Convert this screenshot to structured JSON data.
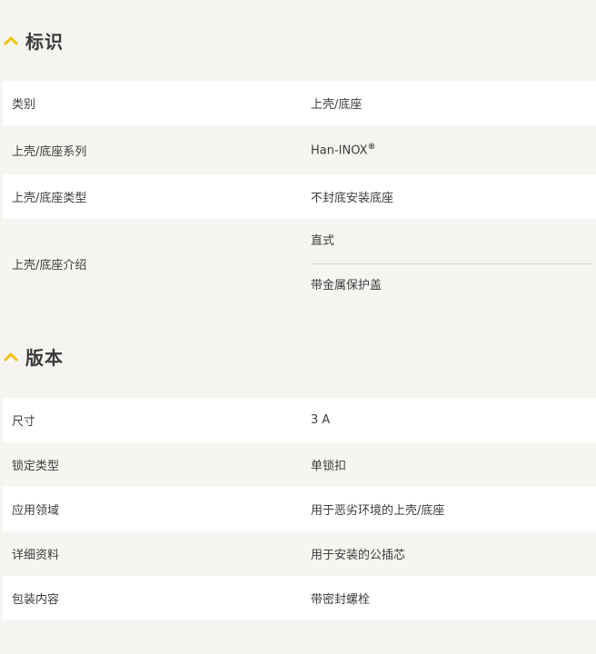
{
  "sections": {
    "identification": {
      "title": "标识",
      "rows": [
        {
          "label": "类别",
          "value": "上壳/底座"
        },
        {
          "label": "上壳/底座系列",
          "value": "Han-INOX",
          "value_sup": "®"
        },
        {
          "label": "上壳/底座类型",
          "value": "不封底安装底座"
        },
        {
          "label": "上壳/底座介绍",
          "values": [
            "直式",
            "带金属保护盖"
          ]
        }
      ]
    },
    "version": {
      "title": "版本",
      "rows": [
        {
          "label": "尺寸",
          "value": "3 A"
        },
        {
          "label": "锁定类型",
          "value": "单锁扣"
        },
        {
          "label": "应用领域",
          "value": "用于恶劣环境的上壳/底座"
        },
        {
          "label": "详细资料",
          "value": "用于安装的公插芯"
        },
        {
          "label": "包装内容",
          "value": "带密封螺栓"
        }
      ]
    }
  },
  "colors": {
    "accent": "#f2c300",
    "background": "#f5f4f1",
    "row_white": "#ffffff",
    "row_grey": "#f6f5f2"
  },
  "icons": {
    "section_toggle": "chevron-up-icon"
  }
}
